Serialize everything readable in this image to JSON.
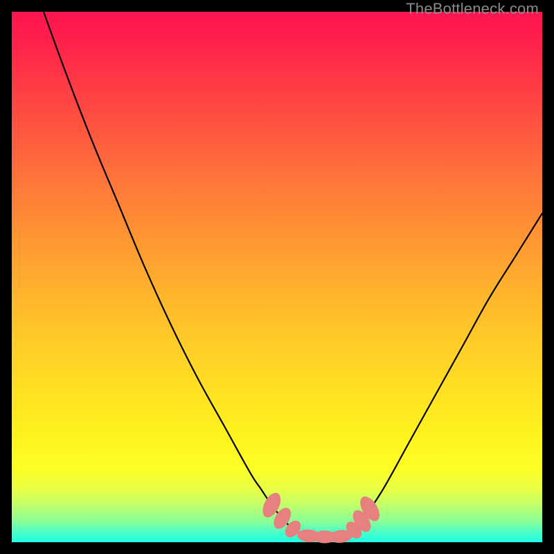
{
  "watermark": "TheBottleneck.com",
  "chart_data": {
    "type": "line",
    "title": "",
    "xlabel": "",
    "ylabel": "",
    "xlim": [
      0,
      100
    ],
    "ylim": [
      0,
      100
    ],
    "series": [
      {
        "name": "bottleneck-curve",
        "x": [
          6,
          10,
          15,
          20,
          25,
          30,
          35,
          40,
          45,
          47,
          49,
          51,
          53,
          55,
          57,
          60,
          62,
          63,
          65,
          66,
          70,
          75,
          80,
          85,
          90,
          95,
          100
        ],
        "y": [
          100,
          89,
          76,
          64,
          52,
          41,
          31,
          22,
          13,
          10,
          7,
          4.5,
          2.5,
          1.5,
          1,
          1,
          1,
          1.3,
          2.5,
          4,
          10,
          19,
          28,
          37,
          46,
          54,
          62
        ]
      }
    ],
    "markers": [
      {
        "name": "beads",
        "color": "#e6817f",
        "points": [
          {
            "x": 49,
            "y": 7,
            "rx": 1.4,
            "ry": 2.5,
            "rot": 27
          },
          {
            "x": 51,
            "y": 4.5,
            "rx": 1.3,
            "ry": 2.2,
            "rot": 32
          },
          {
            "x": 53,
            "y": 2.5,
            "rx": 1.2,
            "ry": 1.8,
            "rot": 40
          },
          {
            "x": 56,
            "y": 1.2,
            "rx": 2.2,
            "ry": 1.2,
            "rot": 5
          },
          {
            "x": 59,
            "y": 1.0,
            "rx": 2.2,
            "ry": 1.2,
            "rot": 0
          },
          {
            "x": 62,
            "y": 1.1,
            "rx": 2.2,
            "ry": 1.2,
            "rot": -6
          },
          {
            "x": 64.5,
            "y": 2.3,
            "rx": 1.2,
            "ry": 1.8,
            "rot": -38
          },
          {
            "x": 66.0,
            "y": 4.0,
            "rx": 1.3,
            "ry": 2.3,
            "rot": -34
          },
          {
            "x": 67.5,
            "y": 6.3,
            "rx": 1.4,
            "ry": 2.6,
            "rot": -32
          }
        ]
      }
    ]
  }
}
